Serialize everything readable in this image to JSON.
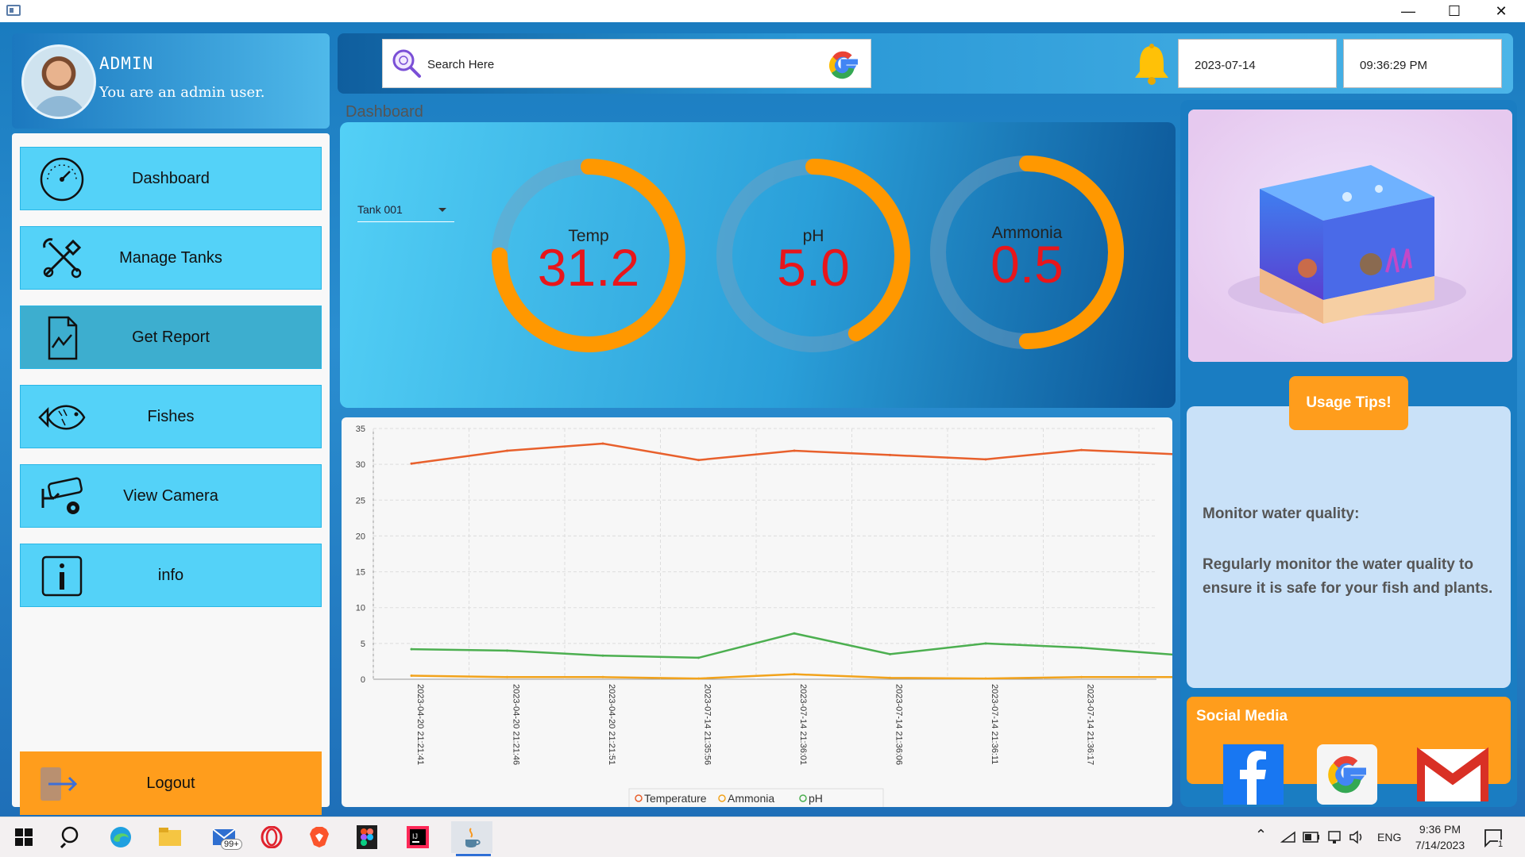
{
  "window": {
    "minimize": "—",
    "maximize": "☐",
    "close": "✕"
  },
  "profile": {
    "name": "ADMIN",
    "role": "You are an admin user."
  },
  "nav": [
    {
      "label": "Dashboard",
      "icon": "speedometer-icon"
    },
    {
      "label": "Manage Tanks",
      "icon": "tools-icon"
    },
    {
      "label": "Get Report",
      "icon": "report-icon"
    },
    {
      "label": "Fishes",
      "icon": "fish-icon"
    },
    {
      "label": "View Camera",
      "icon": "camera-icon"
    },
    {
      "label": "info",
      "icon": "info-icon"
    }
  ],
  "active_nav": "Get Report",
  "logout": {
    "label": "Logout",
    "icon": "logout-icon"
  },
  "search": {
    "placeholder": "Search Here"
  },
  "header": {
    "date": "2023-07-14",
    "time": "09:36:29 PM"
  },
  "page_title": "Dashboard",
  "tank_select": {
    "value": "Tank 001"
  },
  "gauges": [
    {
      "label": "Temp",
      "value": "31.2",
      "fill": 0.75
    },
    {
      "label": "pH",
      "value": "5.0",
      "fill": 0.42
    },
    {
      "label": "Ammonia",
      "value": "0.5",
      "fill": 0.5
    }
  ],
  "colors": {
    "gauge_arc": "#ff9800",
    "gauge_value": "#e8161b",
    "accent_orange": "#ff9d1c",
    "nav_blue": "#54d2f8"
  },
  "chart_data": {
    "type": "line",
    "categories": [
      "2023-04-20 21:21:41",
      "2023-04-20 21:21:46",
      "2023-04-20 21:21:51",
      "2023-07-14 21:35:56",
      "2023-07-14 21:36:01",
      "2023-07-14 21:36:06",
      "2023-07-14 21:36:11",
      "2023-07-14 21:36:17"
    ],
    "series": [
      {
        "name": "Temperature",
        "color": "#e8602c",
        "values": [
          30.1,
          31.9,
          32.9,
          30.6,
          31.9,
          31.3,
          30.7,
          32.0,
          31.4
        ]
      },
      {
        "name": "Ammonia",
        "color": "#f2a31c",
        "values": [
          0.5,
          0.3,
          0.3,
          0.1,
          0.7,
          0.2,
          0.1,
          0.3,
          0.3
        ]
      },
      {
        "name": "pH",
        "color": "#4caf50",
        "values": [
          4.2,
          4.0,
          3.3,
          3.0,
          6.4,
          3.5,
          5.0,
          4.4,
          3.4
        ]
      }
    ],
    "yticks": [
      "0",
      "5",
      "10",
      "15",
      "20",
      "25",
      "30",
      "35"
    ],
    "ylim": [
      0,
      35
    ],
    "grid": true,
    "legend": "bottom"
  },
  "tips": {
    "button": "Usage Tips!",
    "heading": "Monitor water quality:",
    "body": "Regularly monitor the water quality to ensure it is safe for your fish and plants."
  },
  "social": {
    "title": "Social Media",
    "items": [
      "facebook-icon",
      "google-icon",
      "gmail-icon"
    ]
  },
  "taskbar": {
    "mail_badge": "99+",
    "lang": "ENG",
    "time": "9:36 PM",
    "date": "7/14/2023",
    "notif_count": "1"
  }
}
